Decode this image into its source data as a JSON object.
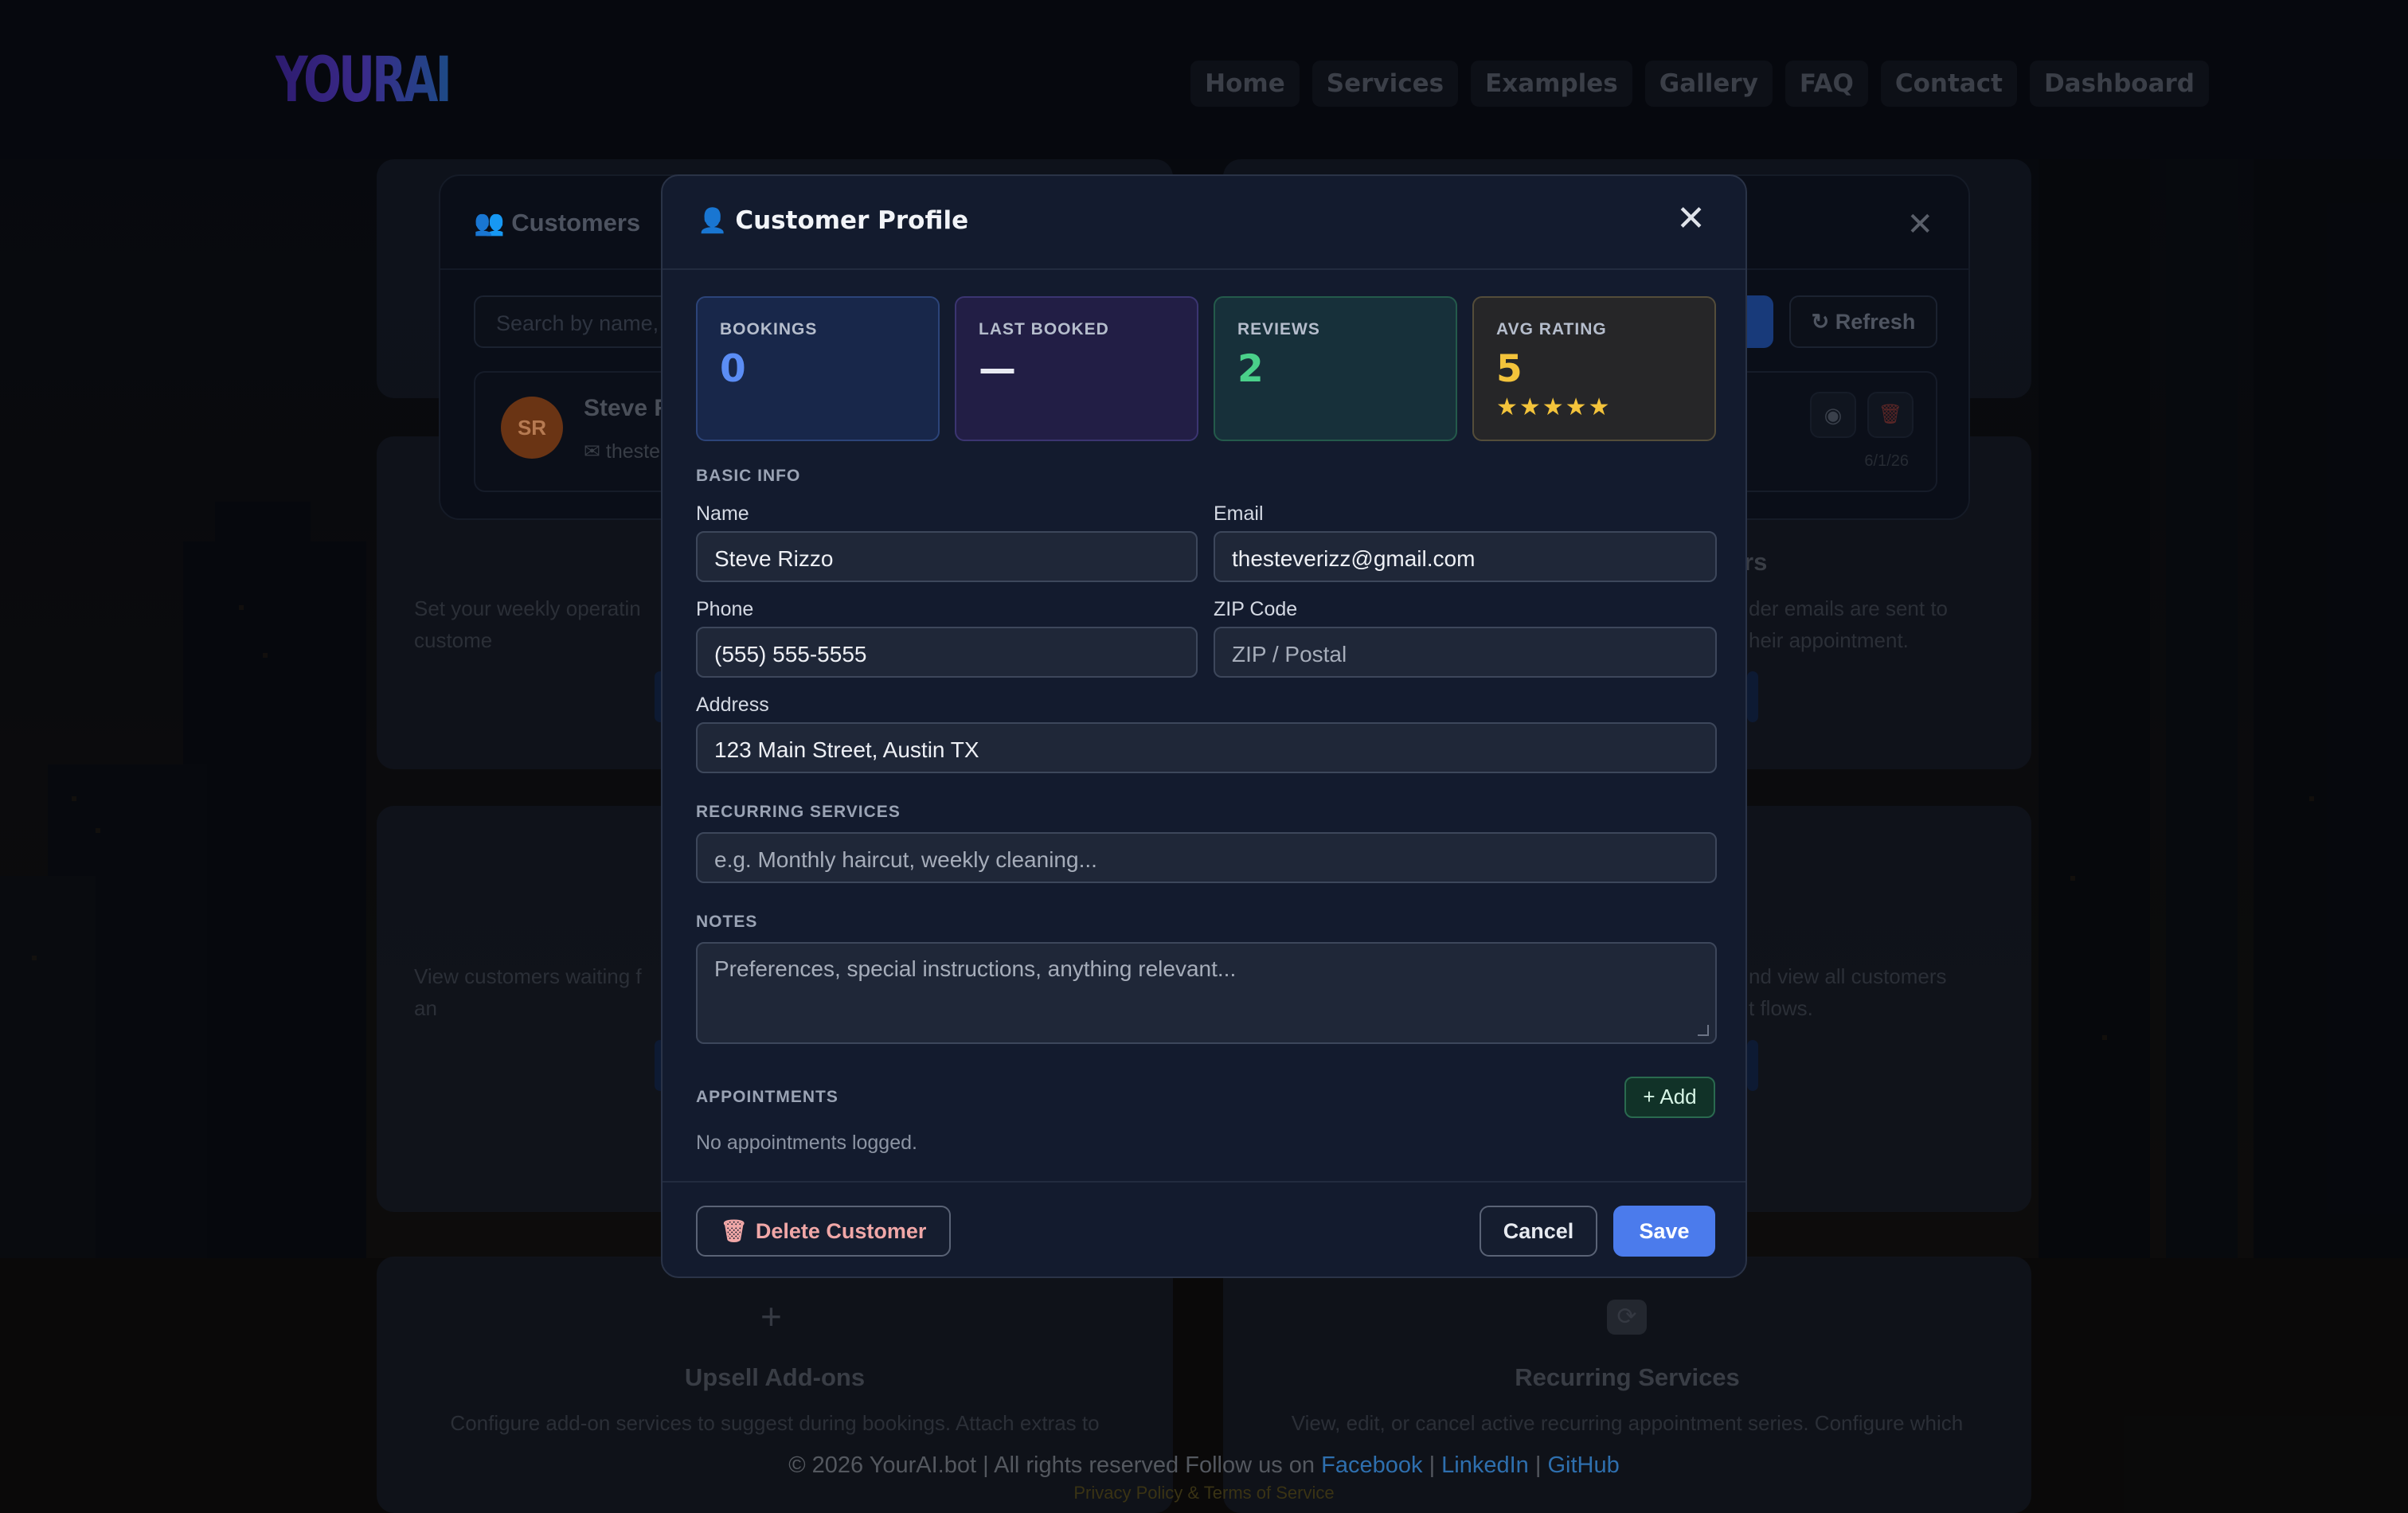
{
  "header": {
    "logo": "YOURAI",
    "nav": [
      "Home",
      "Services",
      "Examples",
      "Gallery",
      "FAQ",
      "Contact",
      "Dashboard"
    ]
  },
  "background_cards": {
    "left_text_1": "Set your weekly operatin\ncustome",
    "right_title_1": "rs",
    "right_text_1": "der emails are sent to\nheir appointment.",
    "left_text_2": "View customers waiting f\nan",
    "right_text_2": "nd view all customers\nt flows.",
    "upsell_title": "Upsell Add-ons",
    "upsell_text": "Configure add-on services to suggest during bookings. Attach extras to",
    "recurring_title": "Recurring Services",
    "recurring_text": "View, edit, or cancel active recurring appointment series. Configure which"
  },
  "customers_panel": {
    "title": "Customers",
    "search_placeholder": "Search by name,",
    "refresh_label": "Refresh",
    "row": {
      "initials": "SR",
      "name": "Steve R",
      "email": "theste",
      "date": "6/1/26"
    }
  },
  "modal": {
    "title": "Customer Profile",
    "stats": [
      {
        "label": "BOOKINGS",
        "value": "0",
        "color": "#5b8df5"
      },
      {
        "label": "LAST BOOKED",
        "value": "—",
        "color": "#e8eaf2"
      },
      {
        "label": "REVIEWS",
        "value": "2",
        "color": "#4ad08a"
      },
      {
        "label": "AVG RATING",
        "value": "5",
        "color": "#f3c33b",
        "stars": 5,
        "stars_text": "★★★★★"
      }
    ],
    "basic_info_heading": "BASIC INFO",
    "fields": {
      "name": {
        "label": "Name",
        "value": "Steve Rizzo"
      },
      "email": {
        "label": "Email",
        "value": "thesteverizz@gmail.com"
      },
      "phone": {
        "label": "Phone",
        "value": "(555) 555-5555"
      },
      "zip": {
        "label": "ZIP Code",
        "value": "",
        "placeholder": "ZIP / Postal"
      },
      "address": {
        "label": "Address",
        "value": "123 Main Street, Austin TX"
      }
    },
    "recurring": {
      "heading": "RECURRING SERVICES",
      "placeholder": "e.g. Monthly haircut, weekly cleaning..."
    },
    "notes": {
      "heading": "NOTES",
      "placeholder": "Preferences, special instructions, anything relevant..."
    },
    "appointments": {
      "heading": "APPOINTMENTS",
      "add_label": "+ Add",
      "empty_text": "No appointments logged."
    },
    "footer": {
      "delete_label": "Delete Customer",
      "cancel_label": "Cancel",
      "save_label": "Save"
    }
  },
  "page_footer": {
    "copyright": "© 2026 YourAI.bot | All rights reserved",
    "follow": "Follow us on",
    "links": [
      "Facebook",
      "LinkedIn",
      "GitHub"
    ],
    "sep": "|",
    "legal": "Privacy Policy & Terms of Service"
  },
  "colors": {
    "accent": "#4b7bec",
    "modal_bg": "#131b2e",
    "danger_text": "#f0a7a7",
    "success": "#4ad08a"
  }
}
